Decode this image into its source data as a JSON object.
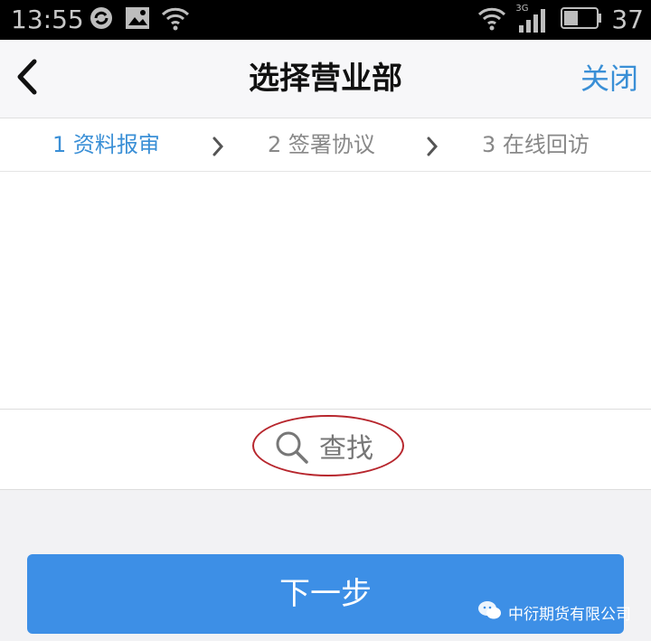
{
  "status_bar": {
    "time": "13:55",
    "network_label": "3G",
    "battery": "37",
    "icons": [
      "sync-icon",
      "image-notification-icon",
      "wifi-icon",
      "wifi-icon",
      "signal-icon",
      "battery-icon"
    ]
  },
  "nav": {
    "title": "选择营业部",
    "close_label": "关闭",
    "back_icon": "chevron-left-icon"
  },
  "steps": [
    {
      "label": "1 资料报审",
      "active": true
    },
    {
      "label": "2 签署协议",
      "active": false
    },
    {
      "label": "3 在线回访",
      "active": false
    }
  ],
  "search": {
    "label": "查找",
    "icon": "search-icon"
  },
  "next_button": {
    "label": "下一步"
  },
  "watermark": {
    "text": "中衍期货有限公司",
    "icon": "wechat-icon"
  },
  "colors": {
    "accent": "#3a8fd6",
    "button": "#3d8fe6",
    "annotation": "#b7262d"
  }
}
